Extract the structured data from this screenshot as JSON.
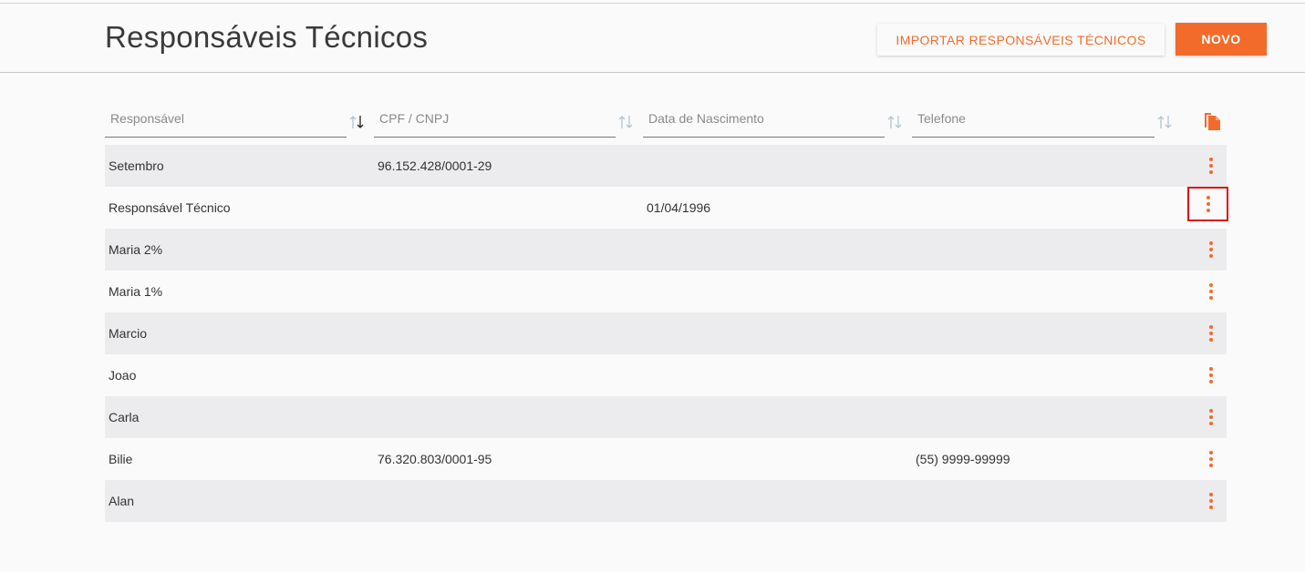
{
  "header": {
    "title": "Responsáveis Técnicos",
    "import_label": "IMPORTAR RESPONSÁVEIS TÉCNICOS",
    "new_label": "NOVO"
  },
  "filters": [
    {
      "placeholder": "Responsável",
      "sort": "asc"
    },
    {
      "placeholder": "CPF / CNPJ",
      "sort": "none"
    },
    {
      "placeholder": "Data de Nascimento",
      "sort": "none"
    },
    {
      "placeholder": "Telefone",
      "sort": "none"
    }
  ],
  "icons": {
    "export": "document-copy-icon",
    "row_menu": "more-vertical-icon",
    "sort": "sort-arrows-icon"
  },
  "colors": {
    "accent": "#f26b2a",
    "highlight": "#e01010",
    "row_alt": "#ececee"
  },
  "rows": [
    {
      "responsavel": "Setembro",
      "cpf_cnpj": "96.152.428/0001-29",
      "nascimento": "",
      "telefone": ""
    },
    {
      "responsavel": "Responsável Técnico",
      "cpf_cnpj": "",
      "nascimento": "01/04/1996",
      "telefone": ""
    },
    {
      "responsavel": "Maria 2%",
      "cpf_cnpj": "",
      "nascimento": "",
      "telefone": ""
    },
    {
      "responsavel": "Maria 1%",
      "cpf_cnpj": "",
      "nascimento": "",
      "telefone": ""
    },
    {
      "responsavel": "Marcio",
      "cpf_cnpj": "",
      "nascimento": "",
      "telefone": ""
    },
    {
      "responsavel": "Joao",
      "cpf_cnpj": "",
      "nascimento": "",
      "telefone": ""
    },
    {
      "responsavel": "Carla",
      "cpf_cnpj": "",
      "nascimento": "",
      "telefone": ""
    },
    {
      "responsavel": "Bilie",
      "cpf_cnpj": "76.320.803/0001-95",
      "nascimento": "",
      "telefone": "(55) 9999-99999"
    },
    {
      "responsavel": "Alan",
      "cpf_cnpj": "",
      "nascimento": "",
      "telefone": ""
    }
  ]
}
